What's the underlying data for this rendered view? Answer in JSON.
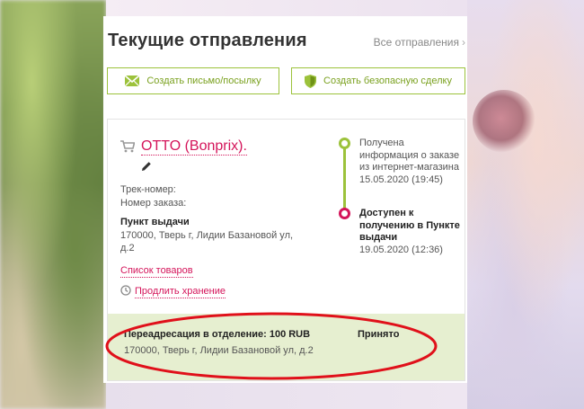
{
  "header": {
    "title": "Текущие отправления",
    "all_link": "Все отправления"
  },
  "actions": {
    "create_letter": "Создать письмо/посылку",
    "create_safe_deal": "Создать безопасную сделку"
  },
  "shipment": {
    "merchant": "OTTO (Bonprix).",
    "track_label": "Трек-номер:",
    "order_label": "Номер заказа:",
    "pickup_title": "Пункт выдачи",
    "pickup_address": "170000, Тверь г, Лидии Базановой ул, д.2",
    "goods_link": "Список товаров",
    "extend_link": "Продлить хранение",
    "timeline": [
      {
        "text": "Получена информация о заказе из интернет-магазина",
        "date": "15.05.2020 (19:45)"
      },
      {
        "text": "Доступен к получению в Пункте выдачи",
        "date": "19.05.2020 (12:36)"
      }
    ],
    "redirect": {
      "title": "Переадресация в отделение: 100 RUB",
      "status": "Принято",
      "address": "170000, Тверь г, Лидии Базановой ул, д.2"
    }
  },
  "colors": {
    "accent_green": "#9cc23b",
    "link_pink": "#d4145a",
    "redirect_bg": "#e6efd0",
    "annotation_red": "#e0101a"
  },
  "icons": {
    "envelope": "envelope-icon",
    "shield": "shield-icon",
    "cart": "cart-icon",
    "pencil": "pencil-icon",
    "clock": "clock-icon",
    "chevron": "chevron-right-icon"
  }
}
